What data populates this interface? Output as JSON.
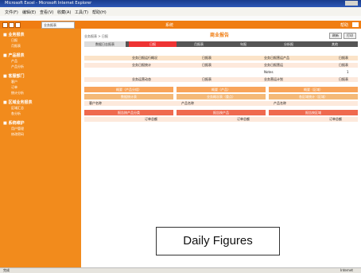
{
  "window": {
    "title": "Microsoft Excel - Microsoft Internet Explorer"
  },
  "menu": [
    "文件(F)",
    "编辑(E)",
    "查看(V)",
    "收藏(A)",
    "工具(T)",
    "帮助(H)"
  ],
  "app_bar": {
    "select_value": "业务报表",
    "center": "系统",
    "right": "帮助"
  },
  "sidebar": {
    "sections": [
      {
        "title": "■ 业务报表",
        "items": [
          "日报",
          "月报表"
        ]
      },
      {
        "title": "■ 产品报表",
        "items": [
          "产品",
          "产品分析"
        ]
      },
      {
        "title": "■ 客服部门",
        "items": [
          "客户",
          "订单",
          "统计分析"
        ]
      },
      {
        "title": "■ 区域业务报表",
        "items": [
          "区域汇总",
          "各分析"
        ]
      },
      {
        "title": "■ 系统维护",
        "items": [
          "用户管理",
          "修改密码"
        ]
      }
    ]
  },
  "main": {
    "crumb": "业务报表 > 日报",
    "title": "商业报告",
    "btn_1": "刷新",
    "btn_2": "打印",
    "tabs": [
      "数据日志报表",
      "日报",
      "月报表",
      "年报",
      "分析报",
      "其他"
    ],
    "rows_a": [
      {
        "a": "业务日报运行概况",
        "b": "日报表",
        "c": "业务日报营运产品",
        "d": "日报表"
      },
      {
        "a": "业务日报统计",
        "b": "日报表",
        "c": "业务日报营运",
        "d": "日报表"
      },
      {
        "a": "",
        "b": "",
        "c": "Notes",
        "d": "1"
      }
    ],
    "row_b": {
      "a": "业务运营动态",
      "b": "日报表",
      "c": "业务营运计划",
      "d": "日报表"
    },
    "group_headers": [
      "概要（产品分组）",
      "概要（产品）",
      "概要（区域）"
    ],
    "group_sub": [
      "数据统计表",
      "业务概况表（重点）",
      "各区域统计（区域）"
    ],
    "group_cells": [
      "客户名称",
      "产品名称",
      "产品名称"
    ],
    "red_headers": [
      "报告按产品分类",
      "报告按产品",
      "报告按区域"
    ],
    "bottom_cells": [
      "订单总额",
      "订单总额",
      "订单总额"
    ],
    "caption": "Daily Figures"
  },
  "status": {
    "left": "完成",
    "right": "Internet"
  }
}
